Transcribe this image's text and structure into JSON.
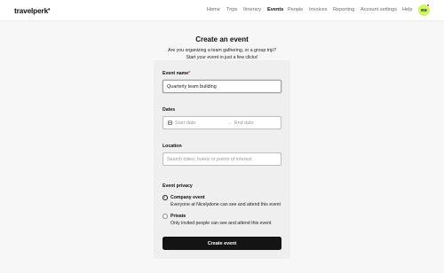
{
  "header": {
    "logo": "travelperk",
    "nav": [
      {
        "label": "Home",
        "active": false
      },
      {
        "label": "Trips",
        "active": false
      },
      {
        "label": "Itinerary",
        "active": false
      },
      {
        "label": "Events",
        "active": true
      },
      {
        "label": "People",
        "active": false
      },
      {
        "label": "Invoices",
        "active": false
      },
      {
        "label": "Reporting",
        "active": false
      },
      {
        "label": "Account settings",
        "active": false
      },
      {
        "label": "Help",
        "active": false
      }
    ],
    "avatar_initials": "BB",
    "avatar_color": "#cdf564",
    "notification_color": "#e0245e"
  },
  "page": {
    "title": "Create an event",
    "subtitle_line1": "Are you organizing a team gathering, or a group trip?",
    "subtitle_line2": "Start your event in just a few clicks!"
  },
  "form": {
    "event_name": {
      "label": "Event name",
      "required_mark": "*",
      "value": "Quarterly team building"
    },
    "dates": {
      "label": "Dates",
      "start_placeholder": "Start date",
      "end_placeholder": "End date",
      "separator": "→"
    },
    "location": {
      "label": "Location",
      "placeholder": "Search cities, hotels or points of interest"
    },
    "privacy": {
      "label": "Event privacy",
      "options": [
        {
          "title": "Company event",
          "description": "Everyone at Nicelydone can see and attend this event",
          "selected": true
        },
        {
          "title": "Private",
          "description": "Only invited people can see and attend this event",
          "selected": false
        }
      ]
    },
    "submit_label": "Create event"
  }
}
